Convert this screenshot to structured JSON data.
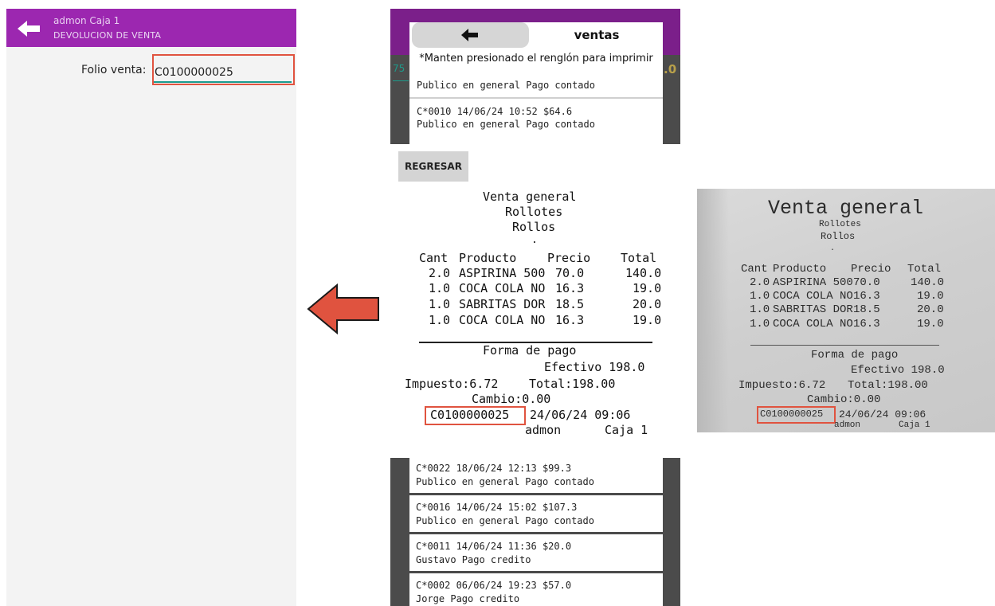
{
  "left_screen": {
    "title_line1": "admon Caja 1",
    "title_line2": "DEVOLUCION DE VENTA",
    "folio_label": "Folio venta:",
    "folio_value": "C0100000025",
    "colors": {
      "appbar": "#9c27b0",
      "underline": "#199a8e",
      "highlight": "#e0533f"
    }
  },
  "middle_top": {
    "dialog_title": "ventas",
    "note": "*Manten presionado el renglón para imprimir",
    "item1_desc": "Publico en general Pago contado",
    "item2_title": "C*0010 14/06/24 10:52 $64.6",
    "item2_desc": "Publico en general Pago contado",
    "peek_left": "75",
    "peek_right": ".0"
  },
  "regresar_label": "REGRESAR",
  "receipt": {
    "title": "Venta general",
    "subtitle1": "Rollotes",
    "subtitle2": "Rollos",
    "dot": ".",
    "headers": [
      "Cant",
      "Producto",
      "Precio",
      "Total"
    ],
    "rows": [
      [
        "2.0",
        "ASPIRINA 500",
        "70.0",
        "140.0"
      ],
      [
        "1.0",
        "COCA COLA NO",
        "16.3",
        "19.0"
      ],
      [
        "1.0",
        "SABRITAS DOR",
        "18.5",
        "20.0"
      ],
      [
        "1.0",
        "COCA COLA NO",
        "16.3",
        "19.0"
      ]
    ],
    "forma_pago": "Forma de pago",
    "efectivo": "Efectivo 198.0",
    "impuesto": "Impuesto:6.72",
    "total": "Total:198.00",
    "cambio": "Cambio:0.00",
    "folio": "C0100000025",
    "datetime": "24/06/24 09:06",
    "user": "admon",
    "caja": "Caja 1"
  },
  "middle_bottom": {
    "items": [
      {
        "title": "C*0022 18/06/24 12:13 $99.3",
        "desc": "Publico en general Pago contado"
      },
      {
        "title": "C*0016 14/06/24 15:02 $107.3",
        "desc": "Publico en general Pago contado"
      },
      {
        "title": "C*0011 14/06/24 11:36 $20.0",
        "desc": "Gustavo Pago credito"
      },
      {
        "title": "C*0002 06/06/24 19:23 $57.0",
        "desc": "Jorge Pago credito"
      }
    ]
  },
  "photo_receipt": {
    "title": "Venta general",
    "subtitle1": "Rollotes",
    "subtitle2": "Rollos",
    "dot": ".",
    "headers": [
      "Cant",
      "Producto",
      "Precio",
      "Total"
    ],
    "rows": [
      [
        "2.0",
        "ASPIRINA 500",
        "70.0",
        "140.0"
      ],
      [
        "1.0",
        "COCA COLA NO",
        "16.3",
        "19.0"
      ],
      [
        "1.0",
        "SABRITAS DOR",
        "18.5",
        "20.0"
      ],
      [
        "1.0",
        "COCA COLA NO",
        "16.3",
        "19.0"
      ]
    ],
    "forma_pago": "Forma de pago",
    "efectivo": "Efectivo 198.0",
    "impuesto": "Impuesto:6.72",
    "total": "Total:198.00",
    "cambio": "Cambio:0.00",
    "folio": "C0100000025",
    "datetime": "24/06/24 09:06",
    "user": "admon",
    "caja": "Caja 1"
  },
  "arrow": {
    "icon": "left-arrow-icon",
    "fill": "#e0533f",
    "stroke": "#1a1a1a"
  }
}
